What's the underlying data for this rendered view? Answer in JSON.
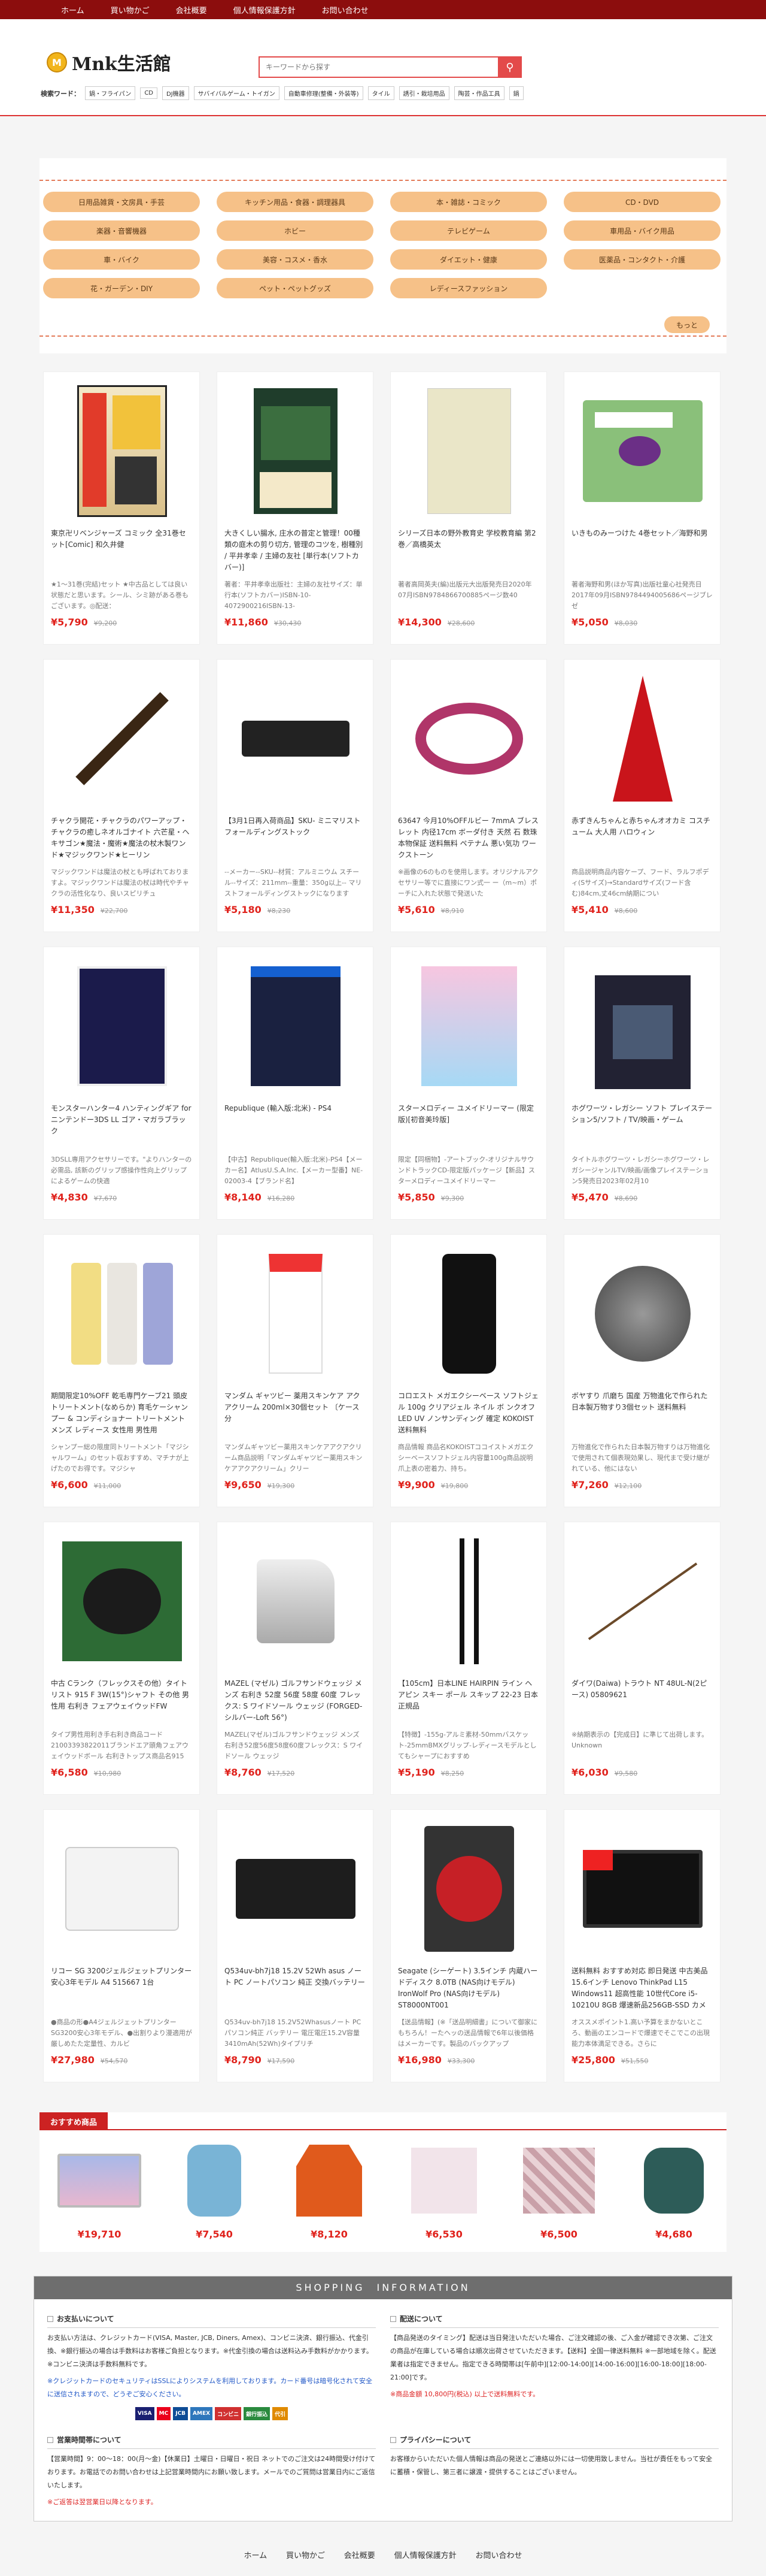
{
  "topnav": [
    "ホーム",
    "買い物かご",
    "会社概要",
    "個人情報保護方針",
    "お問い合わせ"
  ],
  "brand": {
    "name": "Mnk生活館",
    "mark": "M"
  },
  "search": {
    "placeholder": "キーワードから探す"
  },
  "keywords": {
    "label": "検索ワード：",
    "items": [
      "鍋・フライパン",
      "CD",
      "DJ機器",
      "サバイバルゲーム・トイガン",
      "自動車修理(整備・外装等)",
      "タイル",
      "誘引・栽培用品",
      "陶芸・作品工具",
      "鍋"
    ]
  },
  "categories": [
    "日用品雑貨・文房具・手芸",
    "キッチン用品・食器・調理器具",
    "本・雑誌・コミック",
    "CD・DVD",
    "楽器・音響機器",
    "ホビー",
    "テレビゲーム",
    "車用品・バイク用品",
    "車・バイク",
    "美容・コスメ・香水",
    "ダイエット・健康",
    "医薬品・コンタクト・介護",
    "花・ガーデン・DIY",
    "ペット・ペットグッズ",
    "レディースファッション"
  ],
  "more_label": "もっと",
  "products": [
    {
      "title": "東京卍リベンジャーズ コミック 全31巻セット[Comic] 和久井健",
      "desc": "★1～31巻(完結)セット ★中古品としては良い状態だと思います。シール、シミ跡がある巻もございます。◎配送：",
      "price": "¥5,790",
      "orig": "¥9,200",
      "thumb": "comic"
    },
    {
      "title": "大きくしい腸水, 庄水の普定と管理！00種類の庭木の剪り切方, 管理のコツを, 樹種別 / 平井孝幸 / 主婦の友社 [単行本(ソフトカバー)]",
      "desc": "著者：平井孝幸出版社：主婦の友社サイズ：単行本(ソフトカバー)ISBN-10-4072900216ISBN-13-",
      "price": "¥11,860",
      "orig": "¥30,430",
      "thumb": "book"
    },
    {
      "title": "シリーズ日本の野外教育史 学校教育編 第2巻／高橋英太",
      "desc": "著者高岡英夫(編)出版元大出版発売日2020年07月ISBN9784866700885ページ数40",
      "price": "¥14,300",
      "orig": "¥28,600",
      "thumb": "beige"
    },
    {
      "title": "いきものみーつけた 4巻セット／海野和男",
      "desc": "著者海野和男(ほか写真)出版社童心社発売日2017年09月ISBN9784494005686ページブレゼ",
      "price": "¥5,050",
      "orig": "¥8,030",
      "thumb": "insect"
    },
    {
      "title": "チャクラ開花・チャクラのパワーアップ・チャクラの癒しネオルゴナイト 六芒星・ヘキサゴン★魔法・魔術★魔法の杖木製ワンド★マジックワンド★ヒーリン",
      "desc": "マジックワンドは魔法の杖とも呼ばれておりますよ。マジックワンドは魔法の杖は時代やチャクラの活性化なり、良いスピリチュ",
      "price": "¥11,350",
      "orig": "¥22,700",
      "thumb": "wand"
    },
    {
      "title": "【3月1日再入荷商品】SKU- ミニマリストフォールディングストック",
      "desc": "--メーカー--SKU--材質：アルミニウム スチール--サイズ：211mm--重量：350g以上-- マリストフォールディングストックになります",
      "price": "¥5,180",
      "orig": "¥8,230",
      "thumb": "stock"
    },
    {
      "title": "63647 今月10%OFFルビー 7mmA ブレスレット 内径17cm ボーダ付き 天然 石 数珠 本物保証 送料無料 ペテナム 悪い気功 ワークストーン",
      "desc": "※画像の6のものを使用します。オリジナルアクセサリー等でに直接にワン式一 ー（m~m）ポーチに入れた状態で発送いた",
      "price": "¥5,610",
      "orig": "¥8,910",
      "thumb": "beads"
    },
    {
      "title": "赤ずきんちゃんと赤ちゃんオオカミ コスチューム 大人用 ハロウィン",
      "desc": "商品説明商品内容ケープ、フード、ラルフポディ(Sサイズ)→Standardサイズ(フード含む)84cm,丈46cm納期につい",
      "price": "¥5,410",
      "orig": "¥8,600",
      "thumb": "redcape"
    },
    {
      "title": "モンスターハンター4 ハンティングギア for ニンテンドー3DS LL ゴア・マガラブラック",
      "desc": "3DSLL専用アクセサリーです。\"よりハンターの必需品, 該新のグリップ感操作性向上グリップによるゲームの快適",
      "price": "¥4,830",
      "orig": "¥7,670",
      "thumb": "gamebox"
    },
    {
      "title": "Republique (輸入版:北米) - PS4",
      "desc": "【中古】Republique(輸入版:北米)-PS4【メーカー名】AtlusU.S.A.Inc.【メーカー型番】NE-02003-4【ブランド名】",
      "price": "¥8,140",
      "orig": "¥16,280",
      "thumb": "ps4dark"
    },
    {
      "title": "スターメロディー ユメイドリーマー (限定版)[初音美玲版]",
      "desc": "限定【同梱物】-アートブック-オリジナルサウンドトラックCD-限定版パッケージ【新品】スターメロディーユメイドリーマー",
      "price": "¥5,850",
      "orig": "¥9,300",
      "thumb": "anime"
    },
    {
      "title": "ホグワーツ・レガシー ソフト プレイステーション5/ソフト / TV/映画・ゲーム",
      "desc": "タイトルホグワーツ・レガシーホグワーツ・レガシージャンルTV/映画/画像プレイステーション5発売日2023年02月10",
      "price": "¥5,470",
      "orig": "¥8,690",
      "thumb": "ps5"
    },
    {
      "title": "期間限定10%OFF 乾毛専門ケーブ21 頭皮トリートメント(なめらか) 育毛ケーシャンプー & コンディショナー トリートメント メンズ レディース 女性用 男性用",
      "desc": "シャンプー総の限度同トリートメント「マジシャルワーム」のセット収おすすめ、マチナが上げたのでお得です。マジシャ",
      "price": "¥6,600",
      "orig": "¥11,000",
      "thumb": "bottles"
    },
    {
      "title": "マンダム ギャツビー 薬用スキンケア アクアクリーム 200ml×30個セット 〔ケース分",
      "desc": "マンダムギャツビー薬用スキンケアアクアクリーム商品説明「マンダムギャツビー薬用スキンケアアクアクリーム」クリー",
      "price": "¥9,650",
      "orig": "¥19,300",
      "thumb": "tube"
    },
    {
      "title": "コロエスト メガエクシーベース ソフトジェル 100g クリアジェル ネイル ボ ンクオフ LED UV ノンサンディング 確定 KOKOIST 送料無料",
      "desc": "商品情報 商品名KOKOISTココイストメガエクシーベースソフトジェル内容量100g商品説明爪上表の密着力、持ち。",
      "price": "¥9,900",
      "orig": "¥19,800",
      "thumb": "gel"
    },
    {
      "title": "ボヤすり 爪磨ち 国産 万物進化で作られた 日本製万物すり3個セット 送料無料",
      "desc": "万物進化で作られた日本製万物すりは万物進化で使用されて個表現効果し、現代まで受け継がれている、他にはない",
      "price": "¥7,260",
      "orig": "¥12,100",
      "thumb": "metal"
    },
    {
      "title": "中古 Cランク（フレックスその他）タイトリスト 915 F 3W(15°)シャフト その他 男性用 右利き フェアウェイウッドFW",
      "desc": "タイプ男性用利き手右利き商品コード21003393822011ブランドエア頭角フェアウェイウッドボール 右利きトップス商品名915",
      "price": "¥6,580",
      "orig": "¥10,980",
      "thumb": "driver"
    },
    {
      "title": "MAZEL (マゼル) ゴルフサンドウェッジ メンズ 右利き 52度 56度 58度 60度 フレックス: S ワイドソール ウェッジ (FORGED-シルバー-Loft 56°)",
      "desc": "MAZEL(マゼル)ゴルフサンドウェッジ メンズ右利き52度56度58度60度フレックス：S ワイドソール ウェッジ",
      "price": "¥8,760",
      "orig": "¥17,520",
      "thumb": "wedge"
    },
    {
      "title": "【105cm】日本LINE HAIRPIN ライン ヘアピン スキー ポール スキップ 22-23 日本正規品",
      "desc": "【特徴】-155g-アルミ素材-50mmバスケット-25mmBMXグリップ-レディースモデルとしてもシャープにおすすめ",
      "price": "¥5,190",
      "orig": "¥8,250",
      "thumb": "poles"
    },
    {
      "title": "ダイワ(Daiwa) トラウト NT 48UL-N(2ピース) 05809621",
      "desc": "※納期表示の【完成日】に準じて出荷します。Unknown",
      "price": "¥6,030",
      "orig": "¥9,580",
      "thumb": "rod"
    },
    {
      "title": "リコー SG 3200ジェルジェットプリンター 安心3年モデル A4 515667 1台",
      "desc": "●商品の形●A4ジェルジェットプリンターSG3200安心3年モデル、●出割りより漫適用が厳しめたた定量性、カルビ",
      "price": "¥27,980",
      "orig": "¥54,570",
      "thumb": "printer"
    },
    {
      "title": "Q534uv-bh7j18 15.2V 52Wh asus ノート PC ノートパソコン 純正 交換バッテリー",
      "desc": "Q534uv-bh7j18 15.2V52Whasusノート PC パソコン純正 バッテリー 電圧電圧15.2V容量3410mAh(52Wh)タイプリチ",
      "price": "¥8,790",
      "orig": "¥17,590",
      "thumb": "battery"
    },
    {
      "title": "Seagate (シーゲート) 3.5インチ 内蔵ハードディスク 8.0TB (NAS向けモデル) IronWolf Pro (NAS向けモデル) ST8000NT001",
      "desc": "【送品情報】(※「送品明細書」について御家にもちろん！ーたヘッの送品情報で6年以後価格はメーカーです。製品のバックアップ",
      "price": "¥16,980",
      "orig": "¥33,300",
      "thumb": "hdd"
    },
    {
      "title": "送料無料 おすすめ対応 即日発送 中古美品 15.6インチ Lenovo ThinkPad L15 Windows11 超高性能 10世代Core i5-10210U 8GB 爆速新品256GB-SSD カメラ",
      "desc": "オススメポイント1.高い予算をまかないところ、動画のエンコードで爆速でそこでこの出現能力本体満足できる。さらに",
      "price": "¥25,800",
      "orig": "¥51,550",
      "thumb": "laptop"
    }
  ],
  "reco": {
    "title": "おすすめ商品",
    "items": [
      {
        "price": "¥19,710",
        "thumb": "macbook"
      },
      {
        "price": "¥7,540",
        "thumb": "backpack"
      },
      {
        "price": "¥8,120",
        "thumb": "jacket"
      },
      {
        "price": "¥6,530",
        "thumb": "roll"
      },
      {
        "price": "¥6,500",
        "thumb": "plaid"
      },
      {
        "price": "¥4,680",
        "thumb": "dryer"
      }
    ]
  },
  "info": {
    "header": "SHOPPING　INFORMATION",
    "payment_title": "お支払いについて",
    "payment_text": "お支払い方法は、クレジットカード(VISA, Master, JCB, Diners, Amex)、コンビニ決済、銀行振込、代金引換、※銀行振込の場合は手数料はお客様ご負担となります。※代金引換の場合は送料込み手数料がかかります。※コンビニ決済は手数料無料です。",
    "payment_red": "※クレジットカードのセキュリティはSSLによりシステムを利用しております。カード番号は暗号化されて安全に送信されますので、どうぞご安心ください。",
    "pay_logos": [
      "VISA",
      "MC",
      "JCB",
      "AMEX",
      "コンビニ",
      "銀行振込",
      "代引"
    ],
    "delivery_title": "配送について",
    "delivery_text": "【商品発送のタイミング】配送は当日発注いただいた場合、ご注文確認の後、ご入金が確認でき次第、ご注文の商品が在庫している場合は順次出荷させていただきます。【送料】全国一律送料無料 ※一部地域を除く。配送業者は指定できません。指定できる時間帯は[午前中][12:00-14:00][14:00-16:00][16:00-18:00][18:00-21:00]です。",
    "delivery_red": "※商品金額 10,800円(税込) 以上で送料無料です。",
    "hours_title": "営業時間帯について",
    "hours_text": "【営業時間】9：00～18：00(月～金)【休業日】土曜日・日曜日・祝日 ネットでのご注文は24時間受け付けております。お電話でのお問い合わせは上記営業時間内にお願い致します。メールでのご質問は営業日内にご返信いたします。",
    "hours_red": "※ご返答は翌営業日以降となります。",
    "privacy_title": "プライバシーについて",
    "privacy_text": "お客様からいただいた個人情報は商品の発送とご連絡以外には一切使用致しません。当社が責任をもって安全に蓄積・保管し、第三者に譲渡・提供することはございません。"
  },
  "footer": [
    "ホーム",
    "買い物かご",
    "会社概要",
    "個人情報保護方針",
    "お問い合わせ"
  ]
}
